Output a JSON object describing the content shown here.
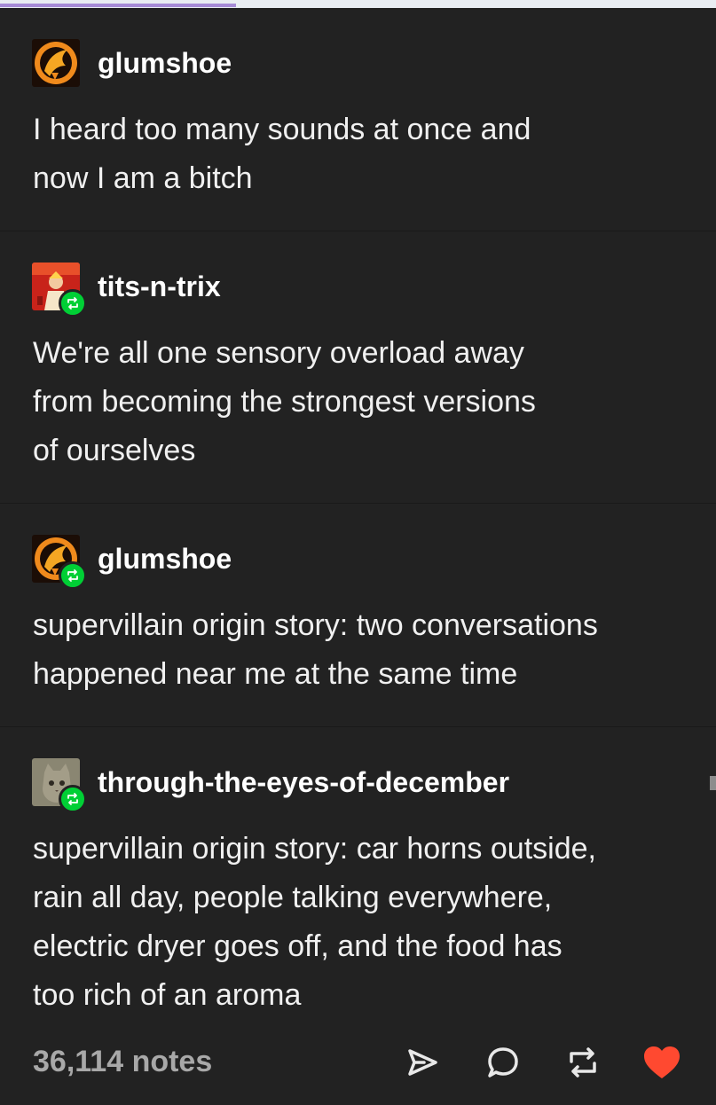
{
  "top_bar": {
    "progress_fraction": 0.33
  },
  "posts": [
    {
      "username": "glumshoe",
      "avatar": "phoenix-avatar",
      "reblogged": false,
      "lines": [
        "I heard too many sounds at once and",
        "now I am a bitch"
      ]
    },
    {
      "username": "tits-n-trix",
      "avatar": "red-figure-avatar",
      "reblogged": true,
      "lines": [
        "We're all one sensory overload away",
        "from becoming the strongest versions",
        "of ourselves"
      ]
    },
    {
      "username": "glumshoe",
      "avatar": "phoenix-avatar",
      "reblogged": true,
      "lines": [
        "supervillain origin story: two conversations",
        "happened near me at the same time"
      ]
    },
    {
      "username": "through-the-eyes-of-december",
      "avatar": "cat-avatar",
      "reblogged": true,
      "lines": [
        "supervillain origin story: car horns outside,",
        "rain all day, people talking everywhere,",
        "electric dryer goes off, and the food has",
        "too rich of an aroma"
      ]
    }
  ],
  "footer": {
    "notes": "36,114 notes",
    "actions": [
      "share-icon",
      "reply-icon",
      "reblog-icon",
      "like-icon"
    ]
  },
  "colors": {
    "background": "#222222",
    "reblog_badge": "#00cf35",
    "like": "#ff4930",
    "notes_text": "#a8a8a8"
  }
}
